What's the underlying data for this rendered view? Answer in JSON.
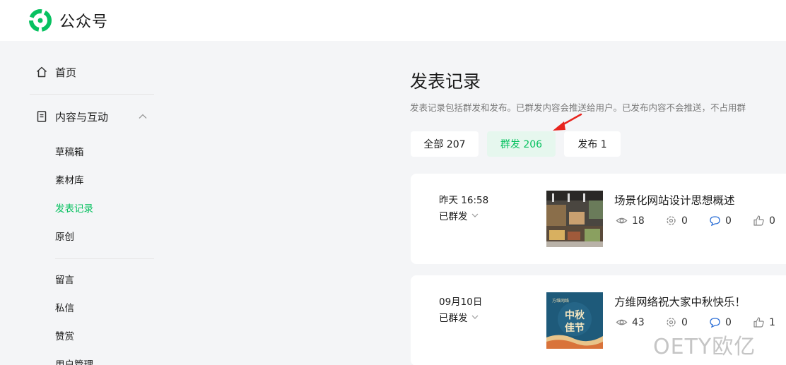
{
  "header": {
    "app_name": "公众号",
    "logo_icon": "wechat-mp-logo-icon",
    "brand_color": "#07c160"
  },
  "sidebar": {
    "home": {
      "label": "首页",
      "icon": "home-icon"
    },
    "group": {
      "label": "内容与互动",
      "icon": "document-icon",
      "expanded": true
    },
    "sub_items": [
      {
        "label": "草稿箱",
        "active": false
      },
      {
        "label": "素材库",
        "active": false
      },
      {
        "label": "发表记录",
        "active": true
      },
      {
        "label": "原创",
        "active": false
      }
    ],
    "sub_items_2": [
      {
        "label": "留言"
      },
      {
        "label": "私信"
      },
      {
        "label": "赞赏"
      },
      {
        "label": "用户管理"
      }
    ]
  },
  "main": {
    "title": "发表记录",
    "description": "发表记录包括群发和发布。已群发内容会推送给用户。已发布内容不会推送，不占用群",
    "tabs": [
      {
        "label": "全部 207",
        "active": false
      },
      {
        "label": "群发 206",
        "active": true
      },
      {
        "label": "发布 1",
        "active": false
      }
    ],
    "records": [
      {
        "date": "昨天 16:58",
        "status": "已群发",
        "title": "场景化网站设计思想概述",
        "stats": {
          "views": "18",
          "shares": "0",
          "comments": "0",
          "likes": "0"
        }
      },
      {
        "date": "09月10日",
        "status": "已群发",
        "title": "方维网络祝大家中秋快乐！",
        "thumb_text": {
          "brand": "方维网络",
          "line1": "中秋",
          "line2": "佳节"
        },
        "stats": {
          "views": "43",
          "shares": "0",
          "comments": "0",
          "likes": "1"
        }
      }
    ]
  },
  "watermark": "OETY欧亿"
}
